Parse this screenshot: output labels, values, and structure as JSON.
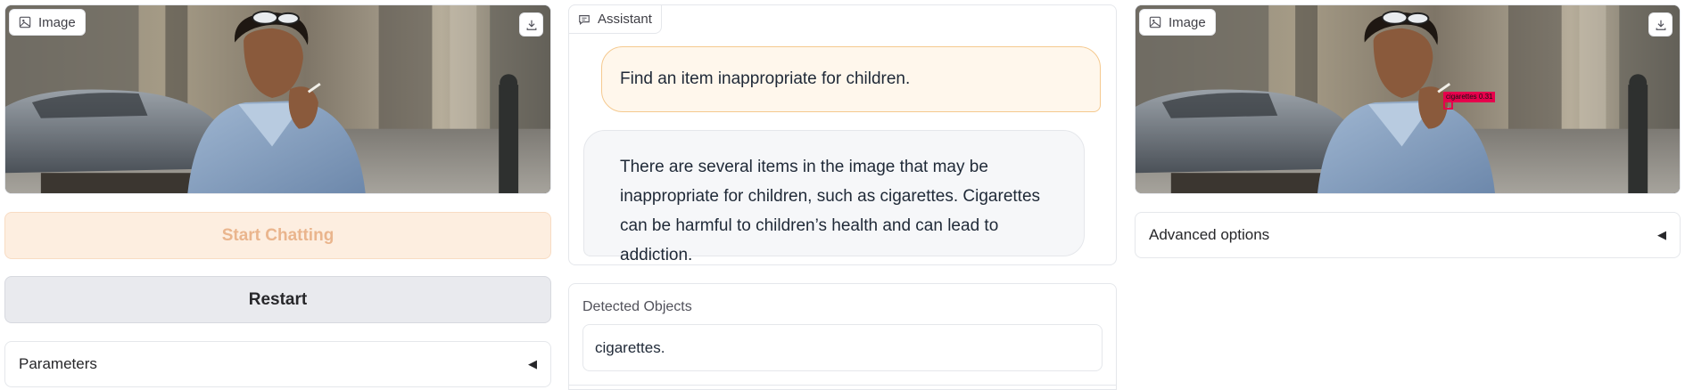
{
  "left": {
    "image_label": "Image",
    "start_button": "Start Chatting",
    "restart_button": "Restart",
    "parameters_label": "Parameters",
    "caret": "◀"
  },
  "chat": {
    "label": "Assistant",
    "user_message": "Find an item inappropriate for children.",
    "bot_message": "There are several items in the image that may be inappropriate for children, such as cigarettes. Cigarettes can be harmful to children’s health and can lead to addiction."
  },
  "detected": {
    "label": "Detected Objects",
    "value": "cigarettes."
  },
  "right": {
    "image_label": "Image",
    "advanced_label": "Advanced options",
    "caret": "◀",
    "detection_tag": "cigarettes 0.31"
  },
  "colors": {
    "accent_light": "#fdeee0",
    "accent_border": "#f5c98f",
    "bbox": "#e6004c"
  },
  "icons": [
    "image-icon",
    "download-icon",
    "chat-icon",
    "caret-left-icon"
  ]
}
